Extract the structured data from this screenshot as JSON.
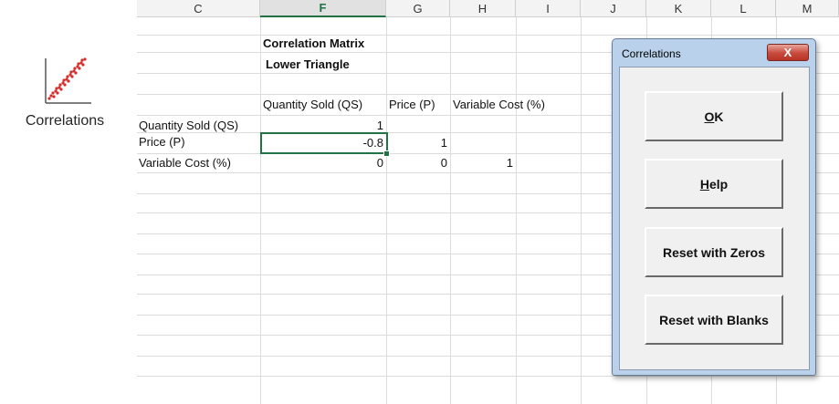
{
  "ribbon": {
    "label": "Correlations",
    "icon": "scatter-plot-icon",
    "accent": "#d32f2f"
  },
  "sheet": {
    "columns": [
      "C",
      "F",
      "G",
      "H",
      "I",
      "J",
      "K",
      "L",
      "M"
    ],
    "active_column": "F",
    "title1": "Correlation Matrix",
    "title2": "Lower Triangle",
    "headers": [
      "Quantity Sold (QS)",
      "Price (P)",
      "Variable Cost (%)"
    ],
    "rows": [
      {
        "label": "Quantity Sold (QS)",
        "values": [
          "1",
          "",
          ""
        ]
      },
      {
        "label": "Price (P)",
        "values": [
          "-0.8",
          "1",
          ""
        ]
      },
      {
        "label": "Variable Cost (%)",
        "values": [
          "0",
          "0",
          "1"
        ]
      }
    ],
    "selected_value": "-0.8",
    "grid_accent": "#217346"
  },
  "dialog": {
    "title": "Correlations",
    "close_label": "X",
    "ok": {
      "hotkey": "O",
      "rest": "K"
    },
    "help": {
      "hotkey": "H",
      "rest": "elp"
    },
    "reset_zeros": "Reset with Zeros",
    "reset_blanks": "Reset with Blanks"
  }
}
